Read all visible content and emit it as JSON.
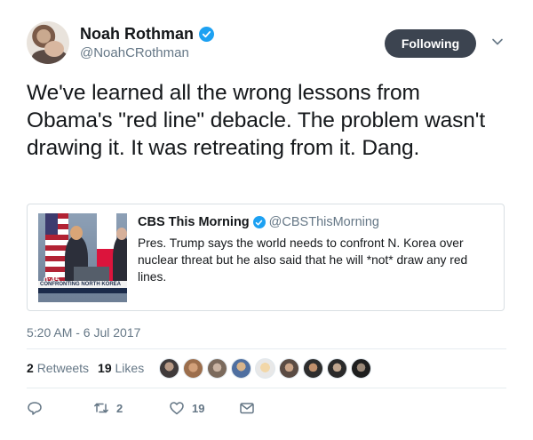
{
  "author": {
    "name": "Noah Rothman",
    "handle": "@NoahCRothman"
  },
  "follow_button": {
    "label": "Following"
  },
  "tweet_text": "We've learned all the wrong lessons from Obama's \"red line\" debacle. The problem wasn't drawing it. It was retreating from it. Dang.",
  "quote": {
    "name": "CBS This Morning",
    "handle": "@CBSThisMorning",
    "text": "Pres. Trump says the world needs to confront N. Korea over nuclear threat but he also said that he will *not* draw any red lines.",
    "thumbnail": {
      "time": "0:45",
      "lower_third": "CONFRONTING NORTH KOREA"
    }
  },
  "timestamp": "5:20 AM - 6 Jul 2017",
  "stats": {
    "retweets_count": "2",
    "retweets_label": "Retweets",
    "likes_count": "19",
    "likes_label": "Likes"
  },
  "actions": {
    "reply_icon": "reply-icon",
    "retweet_icon": "retweet-icon",
    "retweet_count": "2",
    "like_icon": "heart-icon",
    "like_count": "19",
    "dm_icon": "envelope-icon"
  },
  "colors": {
    "verified": "#1da1f2",
    "follow_button_bg": "#3c4450",
    "secondary_text": "#657786",
    "primary_text": "#14171a"
  }
}
